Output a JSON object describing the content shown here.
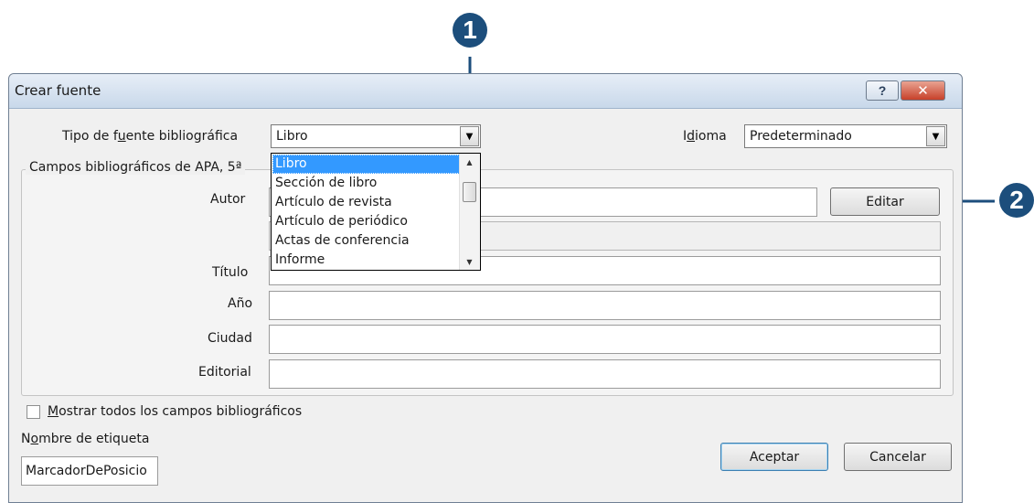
{
  "callouts": {
    "one": "1",
    "two": "2"
  },
  "window": {
    "title": "Crear fuente",
    "help_glyph": "?",
    "close_glyph": "✕"
  },
  "source_type": {
    "label_pre": "Tipo de f",
    "label_acc": "u",
    "label_post": "ente bibliográfica",
    "value": "Libro",
    "arrow": "▼"
  },
  "language": {
    "label_pre": "I",
    "label_acc": "d",
    "label_post": "ioma",
    "value": "Predeterminado",
    "arrow": "▼"
  },
  "group": {
    "legend": "Campos bibliográficos de APA, 5ª"
  },
  "fields": {
    "autor": "Autor",
    "titulo": "Título",
    "anio": "Año",
    "ciudad": "Ciudad",
    "editorial": "Editorial"
  },
  "edit_button": "Editar",
  "dropdown": {
    "items": [
      "Libro",
      "Sección de libro",
      "Artículo de revista",
      "Artículo de periódico",
      "Actas de conferencia",
      "Informe"
    ],
    "up": "▲",
    "down": "▼"
  },
  "show_all": {
    "acc": "M",
    "rest": "ostrar todos los campos bibliográficos"
  },
  "tag_name": {
    "label_pre": "N",
    "label_acc": "o",
    "label_post": "mbre de etiqueta",
    "value": "MarcadorDePosicio"
  },
  "buttons": {
    "ok": "Aceptar",
    "cancel": "Cancelar"
  },
  "colors": {
    "accent": "#1c4e7c",
    "selection": "#3399ff",
    "close": "#c7412a"
  }
}
